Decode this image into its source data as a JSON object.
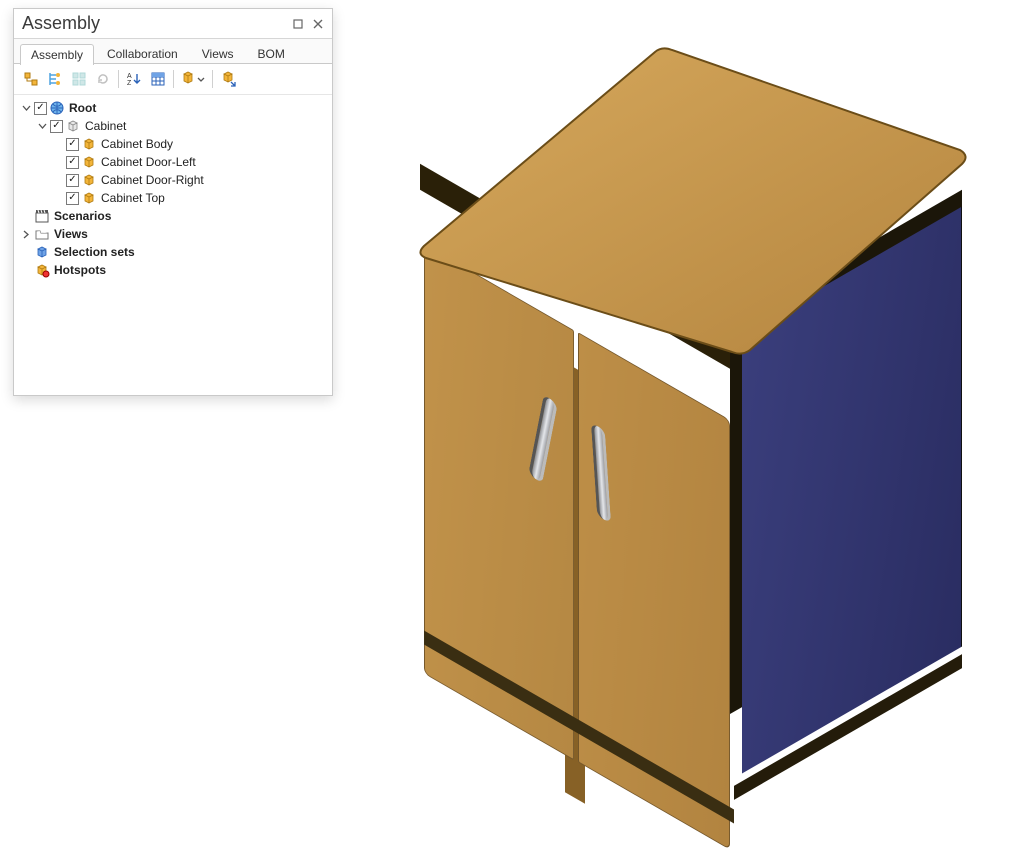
{
  "panel": {
    "title": "Assembly",
    "tabs": [
      {
        "label": "Assembly",
        "active": true
      },
      {
        "label": "Collaboration",
        "active": false
      },
      {
        "label": "Views",
        "active": false
      },
      {
        "label": "BOM",
        "active": false
      }
    ],
    "toolbar_icons": [
      "structure-icon",
      "tree-icon",
      "blocks-icon",
      "refresh-icon",
      "sort-az-icon",
      "table-icon",
      "package-dropdown-icon",
      "select-linked-icon"
    ],
    "tree": [
      {
        "depth": 0,
        "expander": "open",
        "checked": true,
        "icon": "globe",
        "label": "Root",
        "bold": true
      },
      {
        "depth": 1,
        "expander": "open",
        "checked": true,
        "icon": "part",
        "label": "Cabinet",
        "bold": false
      },
      {
        "depth": 2,
        "expander": "none",
        "checked": true,
        "icon": "cube",
        "label": "Cabinet Body",
        "bold": false
      },
      {
        "depth": 2,
        "expander": "none",
        "checked": true,
        "icon": "cube",
        "label": "Cabinet Door-Left",
        "bold": false
      },
      {
        "depth": 2,
        "expander": "none",
        "checked": true,
        "icon": "cube",
        "label": "Cabinet Door-Right",
        "bold": false
      },
      {
        "depth": 2,
        "expander": "none",
        "checked": true,
        "icon": "cube",
        "label": "Cabinet Top",
        "bold": false
      },
      {
        "depth": 0,
        "expander": "none",
        "checked": null,
        "icon": "clap",
        "label": "Scenarios",
        "bold": true
      },
      {
        "depth": 0,
        "expander": "closed",
        "checked": null,
        "icon": "folder",
        "label": "Views",
        "bold": true
      },
      {
        "depth": 0,
        "expander": "none",
        "checked": null,
        "icon": "sel",
        "label": "Selection sets",
        "bold": true
      },
      {
        "depth": 0,
        "expander": "none",
        "checked": null,
        "icon": "hot",
        "label": "Hotspots",
        "bold": true
      }
    ]
  },
  "model": {
    "name": "Cabinet",
    "colors": {
      "wood": "#bd8e47",
      "wood_dark": "#7a5a24",
      "side": "#3a3e7c",
      "handle": "#cfd1d5"
    }
  }
}
